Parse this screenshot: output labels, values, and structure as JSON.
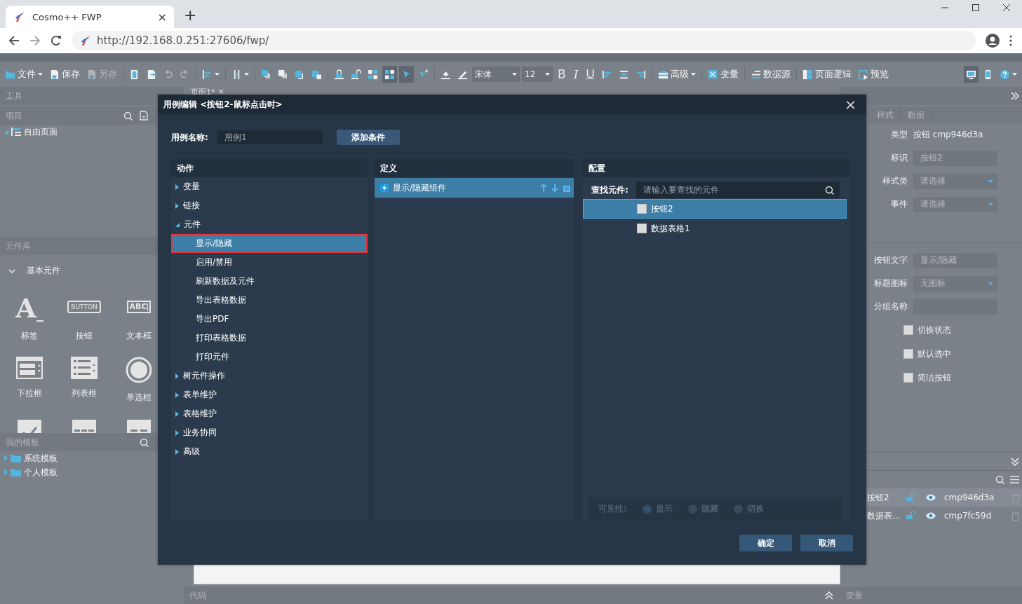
{
  "browser": {
    "tab_title": "Cosmo++ FWP",
    "tab_close": "×",
    "new_tab": "+",
    "url": "http://192.168.0.251:27606/fwp/"
  },
  "toolbar": [
    {
      "kind": "menu",
      "label": "文件",
      "disabled": false,
      "on": false
    },
    {
      "kind": "labeled",
      "label": "保存",
      "disabled": false,
      "on": false
    },
    {
      "kind": "labeled",
      "label": "另存",
      "disabled": true,
      "on": false
    },
    {
      "kind": "sep"
    },
    {
      "kind": "icon",
      "disabled": false,
      "on": false
    },
    {
      "kind": "icon",
      "disabled": false,
      "on": false
    },
    {
      "kind": "icon",
      "disabled": true,
      "on": false
    },
    {
      "kind": "icon",
      "disabled": true,
      "on": false
    },
    {
      "kind": "sep"
    },
    {
      "kind": "menu",
      "disabled": false,
      "on": false
    },
    {
      "kind": "sep"
    },
    {
      "kind": "menu",
      "disabled": false,
      "on": false
    },
    {
      "kind": "sep"
    },
    {
      "kind": "icon",
      "disabled": false,
      "on": false
    },
    {
      "kind": "icon",
      "disabled": false,
      "on": false
    },
    {
      "kind": "icon",
      "disabled": false,
      "on": false
    },
    {
      "kind": "icon",
      "disabled": false,
      "on": false
    },
    {
      "kind": "sep"
    },
    {
      "kind": "icon",
      "disabled": false,
      "on": false
    },
    {
      "kind": "icon",
      "disabled": false,
      "on": false
    },
    {
      "kind": "icon",
      "disabled": false,
      "on": false
    },
    {
      "kind": "icon",
      "disabled": false,
      "on": true
    },
    {
      "kind": "icon",
      "disabled": false,
      "on": true
    },
    {
      "kind": "icon",
      "disabled": false,
      "on": false
    },
    {
      "kind": "sep"
    },
    {
      "kind": "icon",
      "disabled": false,
      "on": false
    },
    {
      "kind": "icon",
      "disabled": false,
      "on": false
    },
    {
      "kind": "select",
      "label": "宋体"
    },
    {
      "kind": "select",
      "label": "12"
    },
    {
      "kind": "glyph",
      "label": "B"
    },
    {
      "kind": "glyph",
      "label": "I"
    },
    {
      "kind": "glyph",
      "label": "U"
    },
    {
      "kind": "icon",
      "disabled": false,
      "on": false
    },
    {
      "kind": "icon",
      "disabled": false,
      "on": false
    },
    {
      "kind": "icon",
      "disabled": false,
      "on": false
    },
    {
      "kind": "sep"
    },
    {
      "kind": "menu",
      "label": "高级",
      "disabled": false,
      "on": false
    },
    {
      "kind": "sep"
    },
    {
      "kind": "labeled",
      "label": "变量",
      "disabled": false,
      "on": false
    },
    {
      "kind": "sep"
    },
    {
      "kind": "labeled",
      "label": "数据源",
      "disabled": false,
      "on": false
    },
    {
      "kind": "sep"
    },
    {
      "kind": "labeled",
      "label": "页面逻辑",
      "disabled": false,
      "on": false
    },
    {
      "kind": "labeled",
      "label": "预览",
      "disabled": false,
      "on": false
    },
    {
      "kind": "spacer"
    },
    {
      "kind": "icon",
      "disabled": false,
      "on": true
    },
    {
      "kind": "icon",
      "disabled": false,
      "on": false
    },
    {
      "kind": "menu",
      "disabled": false,
      "on": false
    }
  ],
  "left_panel": {
    "tools_title": "工具",
    "project": {
      "title": "项目",
      "tree": [
        {
          "label": "自由页面",
          "expanded": true
        }
      ]
    },
    "library": {
      "title": "元件库",
      "group": {
        "label": "基本元件",
        "expanded": true
      },
      "components": [
        {
          "kind": "label",
          "glyph": "A",
          "label": "标签"
        },
        {
          "kind": "button",
          "glyph": "BUTTON",
          "label": "按钮"
        },
        {
          "kind": "textbox",
          "glyph": "ABC",
          "label": "文本框"
        },
        {
          "kind": "dropdown",
          "label": "下拉框"
        },
        {
          "kind": "listbox",
          "label": "列表框"
        },
        {
          "kind": "radio",
          "label": "单选框"
        },
        {
          "kind": "checkbox"
        },
        {
          "kind": "bar3"
        },
        {
          "kind": "bar2"
        }
      ]
    },
    "templates": {
      "title": "我的模板",
      "tree": [
        {
          "label": "系统模板",
          "expanded": false
        },
        {
          "label": "个人模板",
          "expanded": false
        }
      ]
    }
  },
  "editor": {
    "tab": "页面1*",
    "tab_close": "×",
    "code_bar": "代码"
  },
  "right_panel": {
    "tabs": [
      {
        "label": "样式",
        "selected": false
      },
      {
        "label": "数据",
        "selected": false
      }
    ],
    "properties": [
      {
        "kind": "text",
        "label": "类型",
        "value": "按钮 cmp946d3a"
      },
      {
        "kind": "input",
        "label": "标识",
        "value": "按钮2"
      },
      {
        "kind": "select",
        "label": "样式类",
        "placeholder": "请选择"
      },
      {
        "kind": "select",
        "label": "事件",
        "placeholder": "请选择"
      }
    ],
    "button_properties": [
      {
        "kind": "input",
        "label": "按钮文字",
        "value": "显示/隐藏"
      },
      {
        "kind": "select",
        "label": "标题图标",
        "value": "无图标"
      },
      {
        "kind": "input",
        "label": "分组名称"
      }
    ],
    "options": [
      {
        "label": "切换状态",
        "checked": false
      },
      {
        "label": "默认选中",
        "checked": false
      },
      {
        "label": "简洁按钮",
        "checked": false
      }
    ],
    "layers": [
      {
        "name": "按钮2",
        "code": "cmp946d3a",
        "selected": true
      },
      {
        "name": "数据表...",
        "code": "cmp7fc59d",
        "selected": false
      }
    ],
    "variables_bar": "变量"
  },
  "dialog": {
    "title": "用例编辑 <按钮2-鼠标点击时>",
    "close": "×",
    "case_name": {
      "label": "用例名称:",
      "value": "用例1"
    },
    "add_condition": "添加条件",
    "actions": {
      "title": "动作",
      "items": [
        {
          "label": "变量",
          "expanded": false,
          "selected": false
        },
        {
          "label": "链接",
          "expanded": false,
          "selected": false
        },
        {
          "label": "元件",
          "expanded": true,
          "selected": false,
          "children": [
            {
              "label": "显示/隐藏",
              "selected": true,
              "annotated": true
            },
            {
              "label": "启用/禁用",
              "selected": false,
              "annotated": false
            },
            {
              "label": "刷新数据及元件",
              "selected": false,
              "annotated": false
            },
            {
              "label": "导出表格数据",
              "selected": false,
              "annotated": false
            },
            {
              "label": "导出PDF",
              "selected": false,
              "annotated": false
            },
            {
              "label": "打印表格数据",
              "selected": false,
              "annotated": false
            },
            {
              "label": "打印元件",
              "selected": false,
              "annotated": false
            }
          ]
        },
        {
          "label": "树元件操作",
          "expanded": false,
          "selected": false
        },
        {
          "label": "表单维护",
          "expanded": false,
          "selected": false
        },
        {
          "label": "表格维护",
          "expanded": false,
          "selected": false
        },
        {
          "label": "业务协同",
          "expanded": false,
          "selected": false
        },
        {
          "label": "高级",
          "expanded": false,
          "selected": false
        }
      ]
    },
    "definition": {
      "title": "定义",
      "items": [
        {
          "label": "显示/隐藏组件",
          "selected": true
        }
      ]
    },
    "config": {
      "title": "配置",
      "search": {
        "label": "查找元件:",
        "placeholder": "请输入要查找的元件"
      },
      "components": [
        {
          "label": "按钮2",
          "selected": true,
          "checked": false
        },
        {
          "label": "数据表格1",
          "selected": false,
          "checked": false
        }
      ],
      "visibility": {
        "label": "可见性:",
        "disabled": true,
        "options": [
          {
            "label": "显示",
            "selected": true
          },
          {
            "label": "隐藏",
            "selected": false
          },
          {
            "label": "切换",
            "selected": false
          }
        ]
      }
    },
    "buttons": [
      {
        "label": "确定"
      },
      {
        "label": "取消"
      }
    ]
  }
}
